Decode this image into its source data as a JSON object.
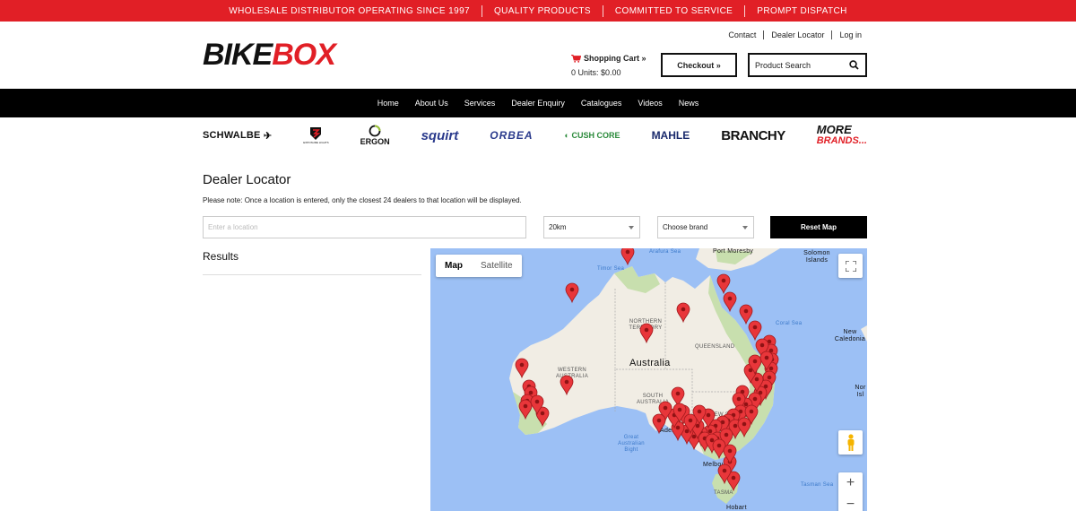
{
  "topbar": {
    "items": [
      "WHOLESALE DISTRIBUTOR OPERATING SINCE 1997",
      "QUALITY PRODUCTS",
      "COMMITTED TO SERVICE",
      "PROMPT DISPATCH"
    ]
  },
  "header": {
    "logo_part1": "BIKE",
    "logo_part2": "BOX",
    "links": [
      "Contact",
      "Dealer Locator",
      "Log in"
    ],
    "cart_label": "Shopping Cart »",
    "cart_units": "0 Units: $0.00",
    "checkout_label": "Checkout »",
    "search_label": "Product Search"
  },
  "nav": {
    "items": [
      "Home",
      "About Us",
      "Services",
      "Dealer Enquiry",
      "Catalogues",
      "Videos",
      "News"
    ]
  },
  "brands": {
    "schwalbe": "SCHWALBE",
    "exposure": "EXPOSURE LIGHTS",
    "ergon": "ERGON",
    "squirt": "squirt",
    "orbea": "ORBEA",
    "cushcore": "CUSH CORE",
    "mahle": "MAHLE",
    "branchy": "BRANCHY",
    "more_line1": "MORE",
    "more_line2": "BRANDS..."
  },
  "locator": {
    "title": "Dealer Locator",
    "note": "Please note: Once a location is entered, only the closest 24 dealers to that location will be displayed.",
    "location_placeholder": "Enter a location",
    "radius_value": "20km",
    "brand_value": "Choose brand",
    "reset_label": "Reset Map",
    "results_label": "Results"
  },
  "map": {
    "toggle_map": "Map",
    "toggle_satellite": "Satellite",
    "labels": {
      "arafura_sea": "Arafura Sea",
      "port_moresby": "Port Moresby",
      "solomon_islands": "Solomon Islands",
      "timor_sea": "Timor Sea",
      "northern_territory": "NORTHERN TERRITORY",
      "coral_sea": "Coral Sea",
      "new_caledonia": "New Caledonia",
      "queensland": "QUEENSLAND",
      "australia": "Australia",
      "western_australia": "WESTERN AUSTRALIA",
      "south_australia": "SOUTH AUSTRALIA",
      "norfolk": "Nor Isl",
      "new_south_wales": "NEW SOUTH WA",
      "adelaide": "Adelaide",
      "great_bight": "Great Australian Bight",
      "melbourne": "Melbourne",
      "tasmania": "TASMA",
      "hobart": "Hobart",
      "tasman_sea": "Tasman Sea"
    },
    "colors": {
      "water": "#9cc0f5",
      "land": "#f1ede4",
      "green": "#c8dfae",
      "marker": "#e8363a"
    }
  }
}
